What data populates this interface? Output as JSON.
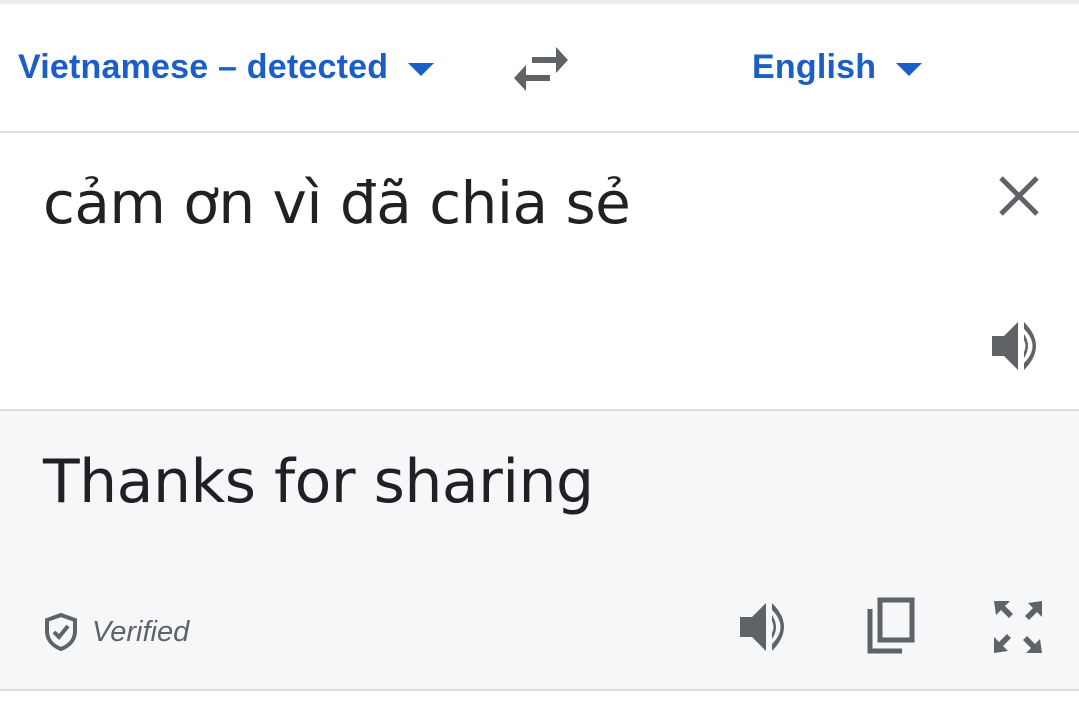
{
  "language_bar": {
    "source_language": "Vietnamese – detected",
    "target_language": "English",
    "swap_icon": "swap-arrows-icon",
    "dropdown_icon": "caret-down-icon"
  },
  "source": {
    "text": "cảm ơn vì đã chia sẻ",
    "clear_icon": "close-icon",
    "speak_icon": "volume-icon"
  },
  "result": {
    "text": "Thanks for sharing",
    "verified_label": "Verified",
    "verified_icon": "shield-check-icon",
    "actions": [
      "volume-icon",
      "copy-icon",
      "fullscreen-icon"
    ]
  },
  "colors": {
    "accent": "#1a5fc7",
    "text": "#202124",
    "icon": "#5f6368",
    "result_background": "#f6f7f9"
  }
}
